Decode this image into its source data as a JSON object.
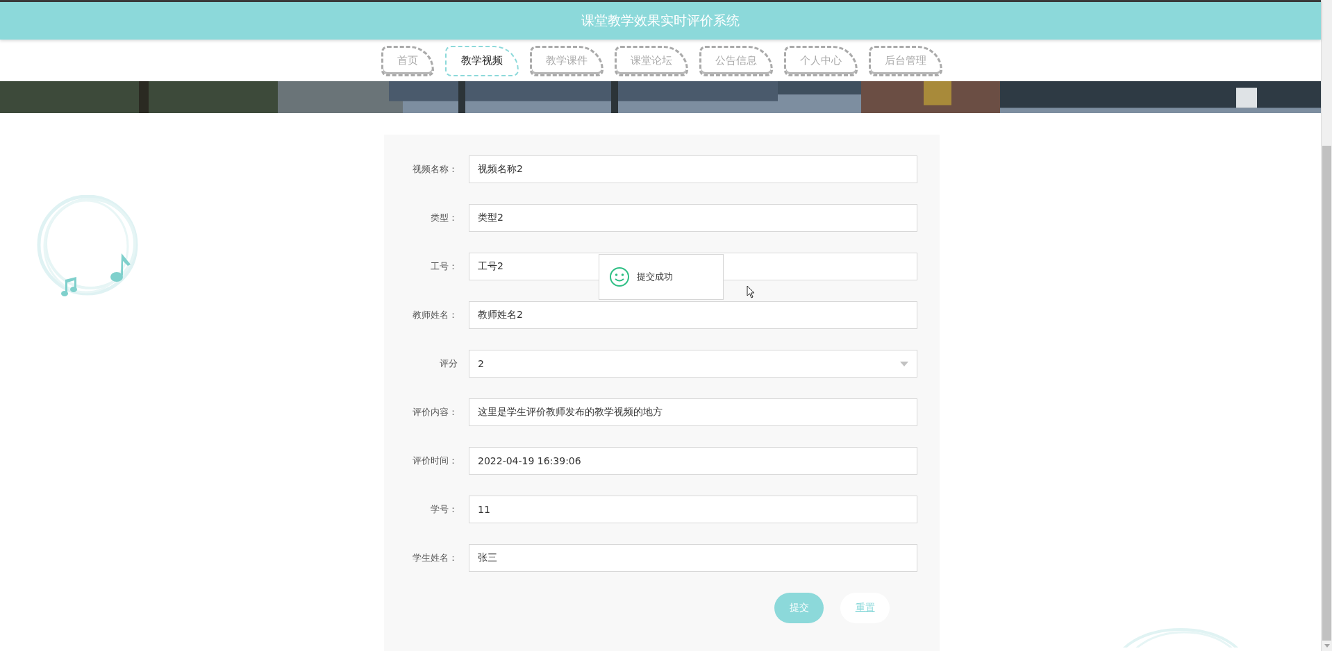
{
  "header": {
    "title": "课堂教学效果实时评价系统"
  },
  "nav": [
    {
      "label": "首页",
      "selected": false
    },
    {
      "label": "教学视频",
      "selected": true
    },
    {
      "label": "教学课件",
      "selected": false
    },
    {
      "label": "课堂论坛",
      "selected": false
    },
    {
      "label": "公告信息",
      "selected": false
    },
    {
      "label": "个人中心",
      "selected": false
    },
    {
      "label": "后台管理",
      "selected": false
    }
  ],
  "form": {
    "fields": [
      {
        "label": "视频名称：",
        "kind": "text",
        "value": "视频名称2"
      },
      {
        "label": "类型：",
        "kind": "text",
        "value": "类型2"
      },
      {
        "label": "工号：",
        "kind": "text",
        "value": "工号2"
      },
      {
        "label": "教师姓名：",
        "kind": "text",
        "value": "教师姓名2"
      },
      {
        "label": "评分",
        "kind": "select",
        "value": "2"
      },
      {
        "label": "评价内容：",
        "kind": "text",
        "value": "这里是学生评价教师发布的教学视频的地方"
      },
      {
        "label": "评价时间：",
        "kind": "text",
        "value": "2022-04-19 16:39:06"
      },
      {
        "label": "学号：",
        "kind": "text",
        "value": "11"
      },
      {
        "label": "学生姓名：",
        "kind": "text",
        "value": "张三"
      }
    ],
    "buttons": [
      {
        "label": "提交",
        "kind": "primary"
      },
      {
        "label": "重置",
        "kind": "plain"
      }
    ]
  },
  "toast": {
    "message": "提交成功"
  }
}
